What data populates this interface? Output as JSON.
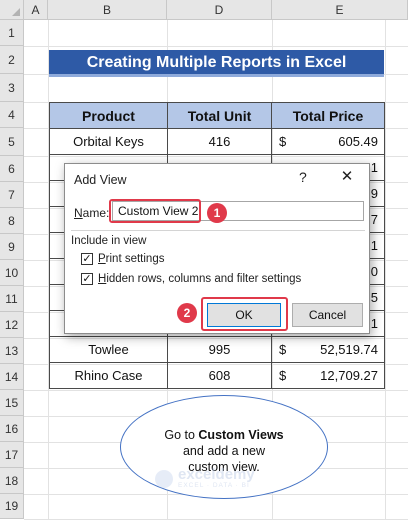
{
  "spreadsheet": {
    "columns": [
      "A",
      "B",
      "D",
      "E"
    ],
    "rows": [
      "1",
      "2",
      "3",
      "4",
      "5",
      "6",
      "7",
      "8",
      "9",
      "10",
      "11",
      "12",
      "13",
      "14",
      "15",
      "16",
      "17",
      "18",
      "19"
    ],
    "title": "Creating Multiple Reports in Excel",
    "table": {
      "headers": [
        "Product",
        "Total Unit",
        "Total Price"
      ],
      "rows": [
        {
          "product": "Orbital Keys",
          "unit": "416",
          "currency": "$",
          "price": "605.49"
        },
        {
          "product": "",
          "unit": "",
          "currency": "",
          "price": "1"
        },
        {
          "product": "",
          "unit": "",
          "currency": "",
          "price": "9"
        },
        {
          "product": "",
          "unit": "",
          "currency": "",
          "price": "7"
        },
        {
          "product": "",
          "unit": "",
          "currency": "",
          "price": "1"
        },
        {
          "product": "",
          "unit": "",
          "currency": "",
          "price": "0"
        },
        {
          "product": "",
          "unit": "",
          "currency": "",
          "price": "5"
        },
        {
          "product": "",
          "unit": "",
          "currency": "",
          "price": "1"
        },
        {
          "product": "Towlee",
          "unit": "995",
          "currency": "$",
          "price": "52,519.74"
        },
        {
          "product": "Rhino Case",
          "unit": "608",
          "currency": "$",
          "price": "12,709.27"
        }
      ]
    }
  },
  "dialog": {
    "title": "Add View",
    "help": "?",
    "close": "✕",
    "name_label_underlined": "N",
    "name_label_rest": "ame:",
    "name_value": "Custom View 2",
    "include_label": "Include in view",
    "print_settings_underlined": "P",
    "print_settings_rest": "rint settings",
    "hidden_underlined": "H",
    "hidden_rest": "idden rows, columns and filter settings",
    "ok_label": "OK",
    "cancel_label": "Cancel"
  },
  "badges": {
    "one": "1",
    "two": "2"
  },
  "callout": {
    "line1_pre": "Go to ",
    "line1_bold": "Custom Views",
    "line2": "and add a new",
    "line3": "custom view."
  },
  "watermark": {
    "name": "exceldemy",
    "tagline": "EXCEL · DATA · BI"
  },
  "colors": {
    "title_bg": "#2e5aa6",
    "header_bg": "#b4c7e7",
    "highlight": "#e0394a",
    "callout_border": "#4472c4"
  }
}
